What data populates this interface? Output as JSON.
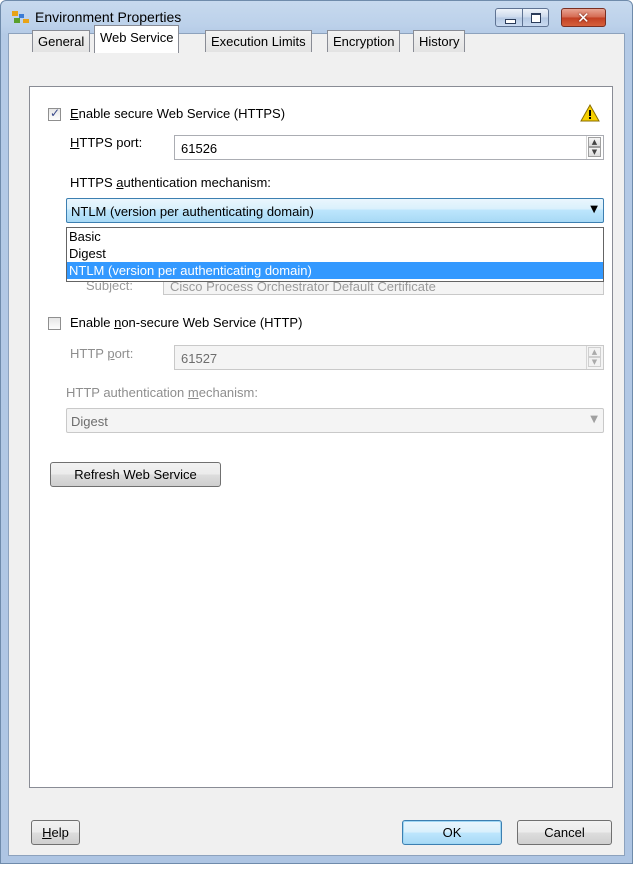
{
  "window": {
    "title": "Environment Properties"
  },
  "tabs": [
    {
      "label": "General"
    },
    {
      "label": "Web Service",
      "active": true
    },
    {
      "label": "Execution Limits"
    },
    {
      "label": "Encryption"
    },
    {
      "label": "History"
    }
  ],
  "https": {
    "checkbox_label_key": "E",
    "checkbox_label_rest": "nable secure Web Service (HTTPS)",
    "checked": true,
    "port_label_key": "H",
    "port_label_rest": "TTPS port:",
    "port_value": "61526",
    "auth_label_pre": "HTTPS ",
    "auth_label_key": "a",
    "auth_label_post": "uthentication mechanism:",
    "auth_selected": "NTLM (version per authenticating domain)",
    "auth_options": [
      "Basic",
      "Digest",
      "NTLM (version per authenticating domain)"
    ],
    "obscured_label": "Subject:",
    "obscured_value": "Cisco Process Orchestrator Default Certificate"
  },
  "http": {
    "checkbox_label_pre": "Enable ",
    "checkbox_label_key": "n",
    "checkbox_label_post": "on-secure Web Service (HTTP)",
    "checked": false,
    "port_label_pre": "HTTP ",
    "port_label_key": "p",
    "port_label_post": "ort:",
    "port_value": "61527",
    "auth_label_pre": "HTTP authentication ",
    "auth_label_key": "m",
    "auth_label_post": "echanism:",
    "auth_selected": "Digest"
  },
  "buttons": {
    "refresh": "Refresh Web Service",
    "help_key": "H",
    "help_rest": "elp",
    "ok": "OK",
    "cancel": "Cancel"
  },
  "colors": {
    "selection": "#3399ff",
    "warning": "#f6d000"
  },
  "icons": {
    "app": "app-icon",
    "warning": "warning-icon"
  }
}
